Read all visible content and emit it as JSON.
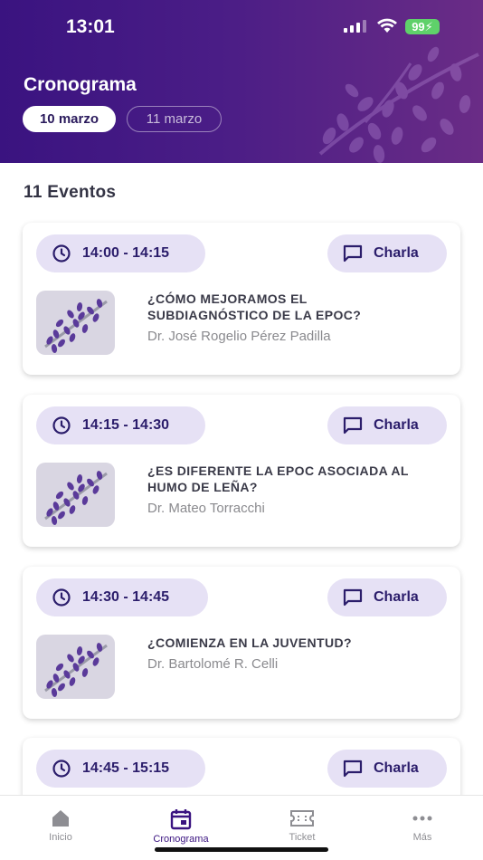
{
  "status_bar": {
    "time": "13:01",
    "battery": "99"
  },
  "header": {
    "title": "Cronograma",
    "dates": [
      {
        "label": "10 marzo",
        "selected": true
      },
      {
        "label": "11 marzo",
        "selected": false
      }
    ]
  },
  "events_count": "11 Eventos",
  "events": [
    {
      "time": "14:00 - 14:15",
      "type": "Charla",
      "title_lines": [
        "¿CÓMO MEJORAMOS EL",
        "SUBDIAGNÓSTICO DE LA EPOC?"
      ],
      "speaker": "Dr. José Rogelio Pérez Padilla"
    },
    {
      "time": "14:15 - 14:30",
      "type": "Charla",
      "title_lines": [
        "¿ES DIFERENTE LA EPOC ASOCIADA AL",
        "HUMO DE LEÑA?"
      ],
      "speaker": "Dr. Mateo Torracchi"
    },
    {
      "time": "14:30 - 14:45",
      "type": "Charla",
      "title_lines": [
        "¿COMIENZA EN LA JUVENTUD?"
      ],
      "speaker": "Dr. Bartolomé R. Celli"
    },
    {
      "time": "14:45 - 15:15",
      "type": "Charla",
      "title_lines": [],
      "speaker": ""
    }
  ],
  "tabbar": [
    {
      "label": "Inicio",
      "icon": "home-icon",
      "active": false
    },
    {
      "label": "Cronograma",
      "icon": "calendar-icon",
      "active": true
    },
    {
      "label": "Ticket",
      "icon": "ticket-icon",
      "active": false
    },
    {
      "label": "Más",
      "icon": "more-icon",
      "active": false
    }
  ],
  "colors": {
    "header_start": "#3a1380",
    "header_end": "#6a2c86",
    "pill_bg": "#e6e1f5",
    "accent": "#2b1d6b"
  }
}
